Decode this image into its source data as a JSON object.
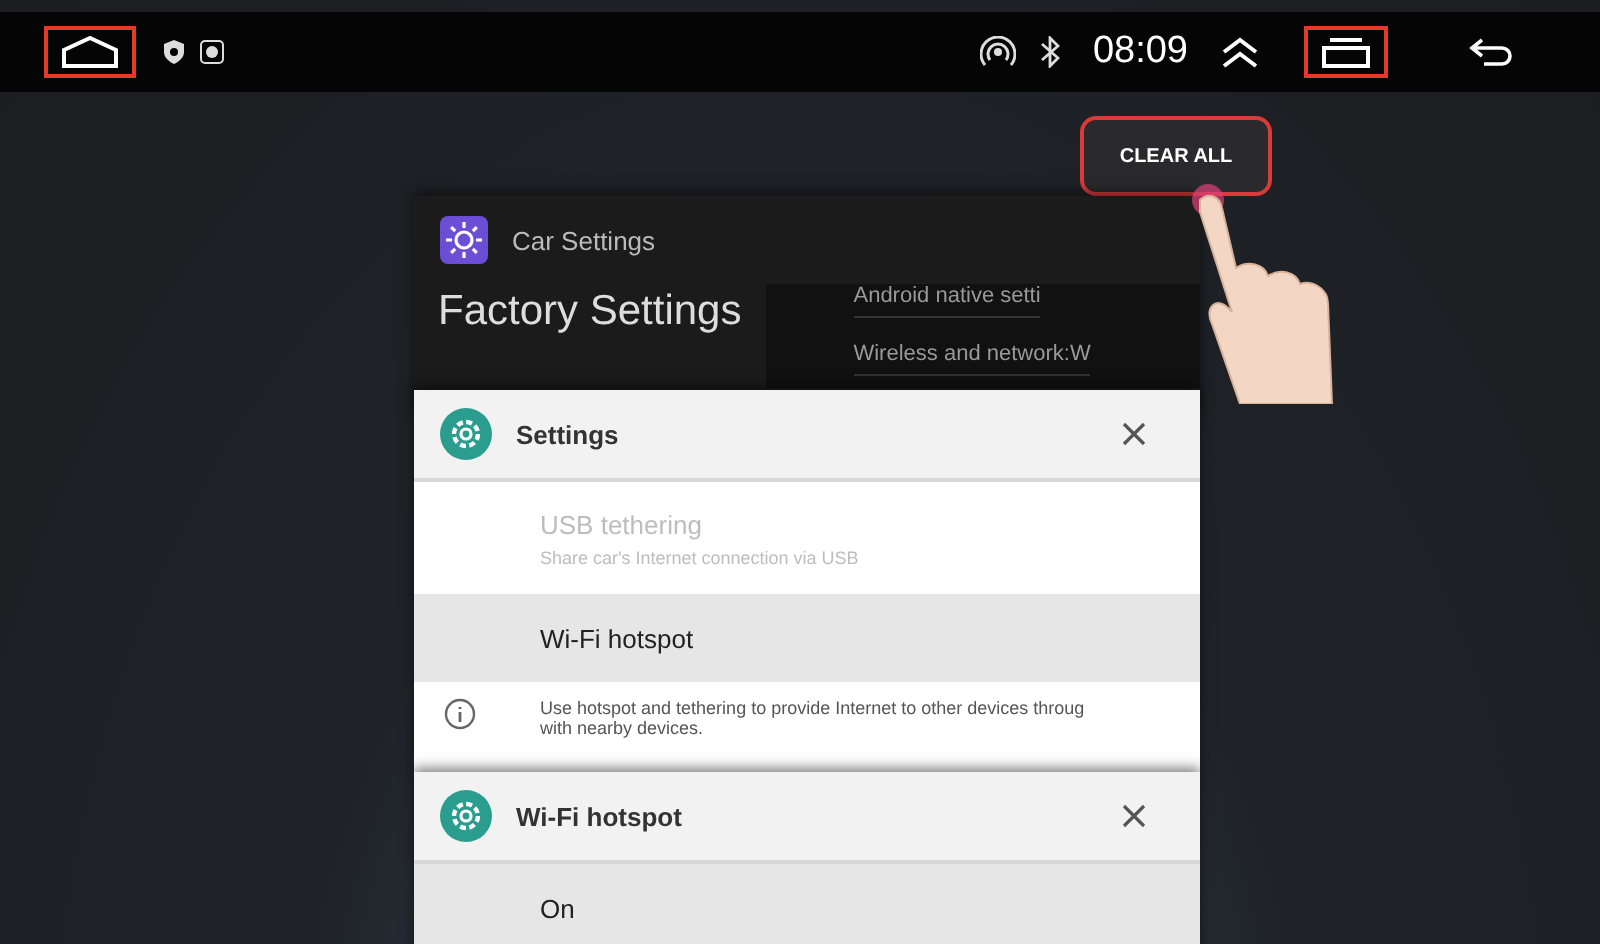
{
  "status_bar": {
    "time": "08:09"
  },
  "clear_all": {
    "label": "CLEAR ALL"
  },
  "cards": [
    {
      "kind": "car",
      "title": "Car Settings",
      "heading": "Factory Settings",
      "items": [
        "Android native setti",
        "Wireless and network:W"
      ]
    },
    {
      "kind": "settings",
      "title": "Settings",
      "rows": [
        {
          "kind": "setting",
          "title": "USB tethering",
          "subtitle": "Share car's Internet connection via USB",
          "disabled": true,
          "selected": false
        },
        {
          "kind": "setting",
          "title": "Wi-Fi hotspot",
          "disabled": false,
          "selected": true
        },
        {
          "kind": "info",
          "lines": [
            "Use hotspot and tethering to provide Internet to other devices throug",
            "with nearby devices."
          ]
        }
      ]
    },
    {
      "kind": "settings",
      "title": "Wi-Fi hotspot",
      "rows": [
        {
          "kind": "setting",
          "title": "On",
          "disabled": false,
          "selected": true
        }
      ]
    }
  ]
}
